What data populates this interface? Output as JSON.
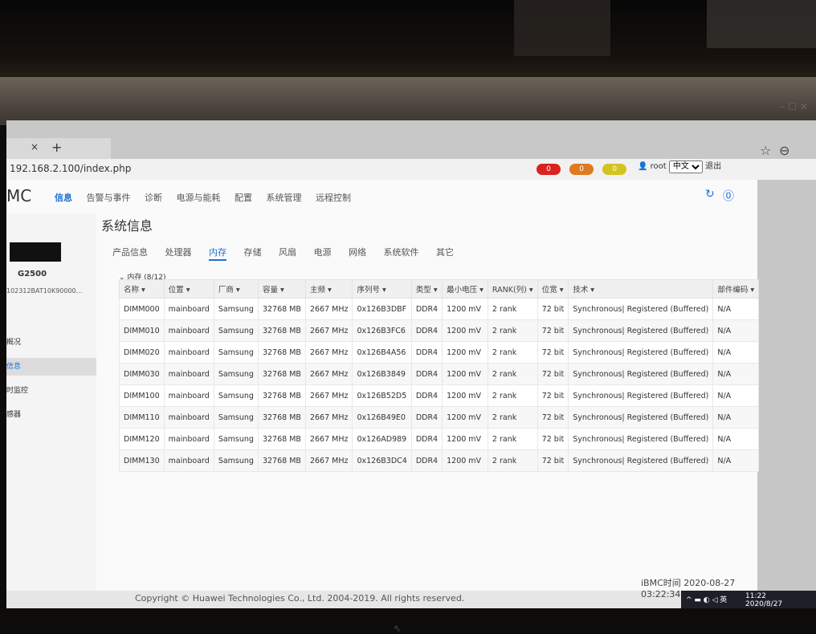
{
  "browser": {
    "url": "192.168.2.100/index.php",
    "tab_close": "×",
    "tab_new": "+",
    "win_ctrl": "–  ☐  ✕",
    "bookmark_icon": "☆",
    "account_icon": "⊖"
  },
  "header": {
    "brand": "MC",
    "nav": [
      "信息",
      "告警与事件",
      "诊断",
      "电源与能耗",
      "配置",
      "系统管理",
      "远程控制"
    ],
    "alerts": [
      {
        "value": "0",
        "color": "#d9231d"
      },
      {
        "value": "0",
        "color": "#e07a1f"
      },
      {
        "value": "0",
        "color": "#d4c220"
      }
    ],
    "user": "root",
    "language": "中文",
    "logout": "退出"
  },
  "sidebar": {
    "model": "G2500",
    "serial": "102312BAT10K90000...",
    "items": [
      "概况",
      "信息",
      "时监控",
      "感器"
    ]
  },
  "main": {
    "page_title": "系统信息",
    "subtabs": [
      "产品信息",
      "处理器",
      "内存",
      "存储",
      "风扇",
      "电源",
      "网络",
      "系统软件",
      "其它"
    ],
    "memory_title": "内存 (8/12)",
    "columns": [
      "名称",
      "位置",
      "厂商",
      "容量",
      "主频",
      "序列号",
      "类型",
      "最小电压",
      "RANK(列)",
      "位宽",
      "技术",
      "部件编码"
    ],
    "rows": [
      [
        "DIMM000",
        "mainboard",
        "Samsung",
        "32768 MB",
        "2667 MHz",
        "0x126B3DBF",
        "DDR4",
        "1200 mV",
        "2 rank",
        "72 bit",
        "Synchronous| Registered (Buffered)",
        "N/A"
      ],
      [
        "DIMM010",
        "mainboard",
        "Samsung",
        "32768 MB",
        "2667 MHz",
        "0x126B3FC6",
        "DDR4",
        "1200 mV",
        "2 rank",
        "72 bit",
        "Synchronous| Registered (Buffered)",
        "N/A"
      ],
      [
        "DIMM020",
        "mainboard",
        "Samsung",
        "32768 MB",
        "2667 MHz",
        "0x126B4A56",
        "DDR4",
        "1200 mV",
        "2 rank",
        "72 bit",
        "Synchronous| Registered (Buffered)",
        "N/A"
      ],
      [
        "DIMM030",
        "mainboard",
        "Samsung",
        "32768 MB",
        "2667 MHz",
        "0x126B3849",
        "DDR4",
        "1200 mV",
        "2 rank",
        "72 bit",
        "Synchronous| Registered (Buffered)",
        "N/A"
      ],
      [
        "DIMM100",
        "mainboard",
        "Samsung",
        "32768 MB",
        "2667 MHz",
        "0x126B52D5",
        "DDR4",
        "1200 mV",
        "2 rank",
        "72 bit",
        "Synchronous| Registered (Buffered)",
        "N/A"
      ],
      [
        "DIMM110",
        "mainboard",
        "Samsung",
        "32768 MB",
        "2667 MHz",
        "0x126B49E0",
        "DDR4",
        "1200 mV",
        "2 rank",
        "72 bit",
        "Synchronous| Registered (Buffered)",
        "N/A"
      ],
      [
        "DIMM120",
        "mainboard",
        "Samsung",
        "32768 MB",
        "2667 MHz",
        "0x126AD989",
        "DDR4",
        "1200 mV",
        "2 rank",
        "72 bit",
        "Synchronous| Registered (Buffered)",
        "N/A"
      ],
      [
        "DIMM130",
        "mainboard",
        "Samsung",
        "32768 MB",
        "2667 MHz",
        "0x126B3DC4",
        "DDR4",
        "1200 mV",
        "2 rank",
        "72 bit",
        "Synchronous| Registered (Buffered)",
        "N/A"
      ]
    ]
  },
  "footer": {
    "copyright": "Copyright © Huawei Technologies Co., Ltd. 2004-2019. All rights reserved.",
    "ibmc_time": "iBMC时间  2020-08-27 03:22:34",
    "clock_time": "11:22",
    "clock_date": "2020/8/27",
    "tray": "^ ▬ ◐ ◁ 英"
  }
}
